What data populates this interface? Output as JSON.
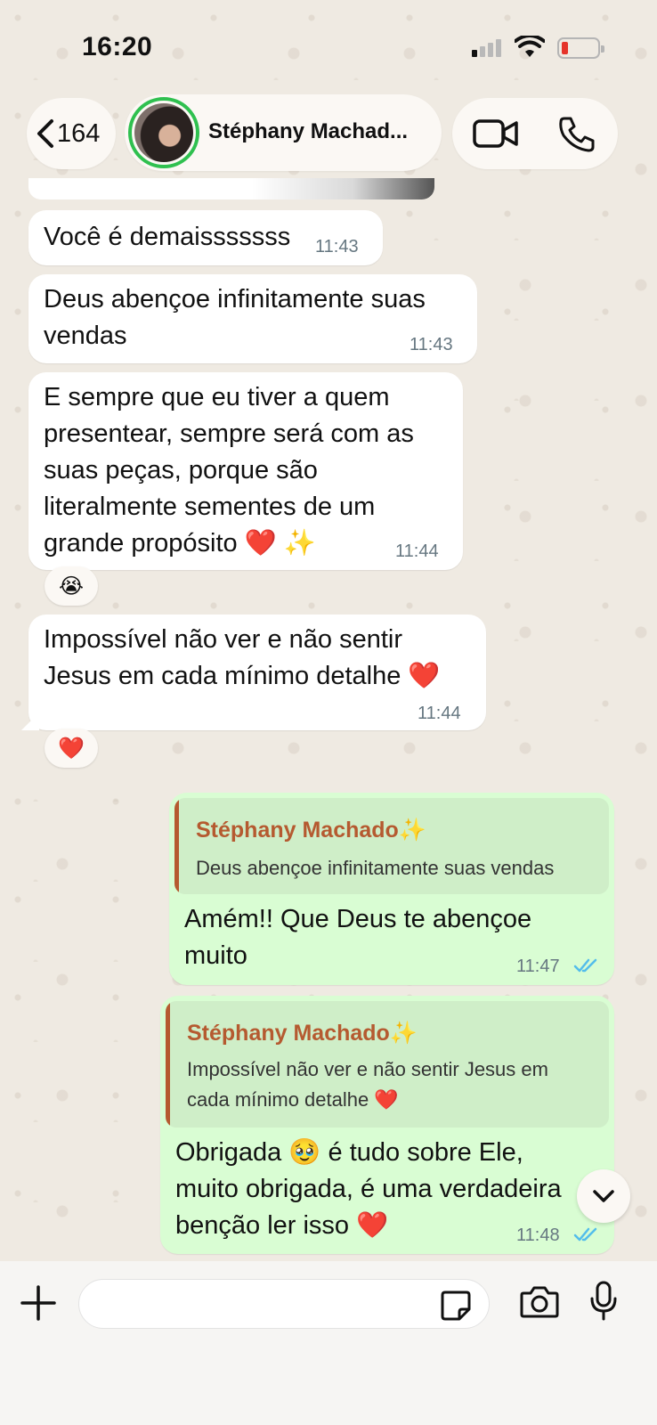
{
  "status_bar": {
    "time": "16:20",
    "battery_level": 0.1
  },
  "header": {
    "back_count": "164",
    "contact_name": "Stéphany Machad...",
    "icons": [
      "chevron-left-icon",
      "video-call-icon",
      "phone-call-icon"
    ]
  },
  "messages": [
    {
      "direction": "in",
      "text": "Você é demaisssssss",
      "time": "11:43"
    },
    {
      "direction": "in",
      "text": "Deus abençoe infinitamente suas\nvendas",
      "time": "11:43"
    },
    {
      "direction": "in",
      "text": "E sempre que eu tiver a quem\npresentear, sempre será com as\nsuas peças, porque são\nliteralmente sementes de um\ngrande propósito ❤️ ✨",
      "time": "11:44",
      "reaction": "😭"
    },
    {
      "direction": "in",
      "text": "Impossível não ver e não sentir\nJesus em cada mínimo detalhe ❤️",
      "time": "11:44",
      "reaction": "❤️"
    },
    {
      "direction": "out",
      "quote_name": "Stéphany Machado✨",
      "quote_text": "Deus abençoe infinitamente suas vendas",
      "text": "Amém!! Que Deus te abençoe\nmuito",
      "time": "11:47",
      "status": "read"
    },
    {
      "direction": "out",
      "quote_name": "Stéphany Machado✨",
      "quote_text": "Impossível não ver e não sentir Jesus em\ncada mínimo detalhe ❤️",
      "text": "Obrigada 🥹 é tudo sobre Ele,\nmuito obrigada, é uma verdadeira\nbenção ler isso ❤️",
      "time": "11:48",
      "status": "read"
    }
  ],
  "composer": {
    "placeholder": "",
    "value": ""
  },
  "colors": {
    "incoming_bubble": "#ffffff",
    "outgoing_bubble": "#d9fdd3",
    "read_ticks": "#53bdeb",
    "quote_accent": "#b55a30",
    "avatar_ring": "#2fc04f"
  }
}
